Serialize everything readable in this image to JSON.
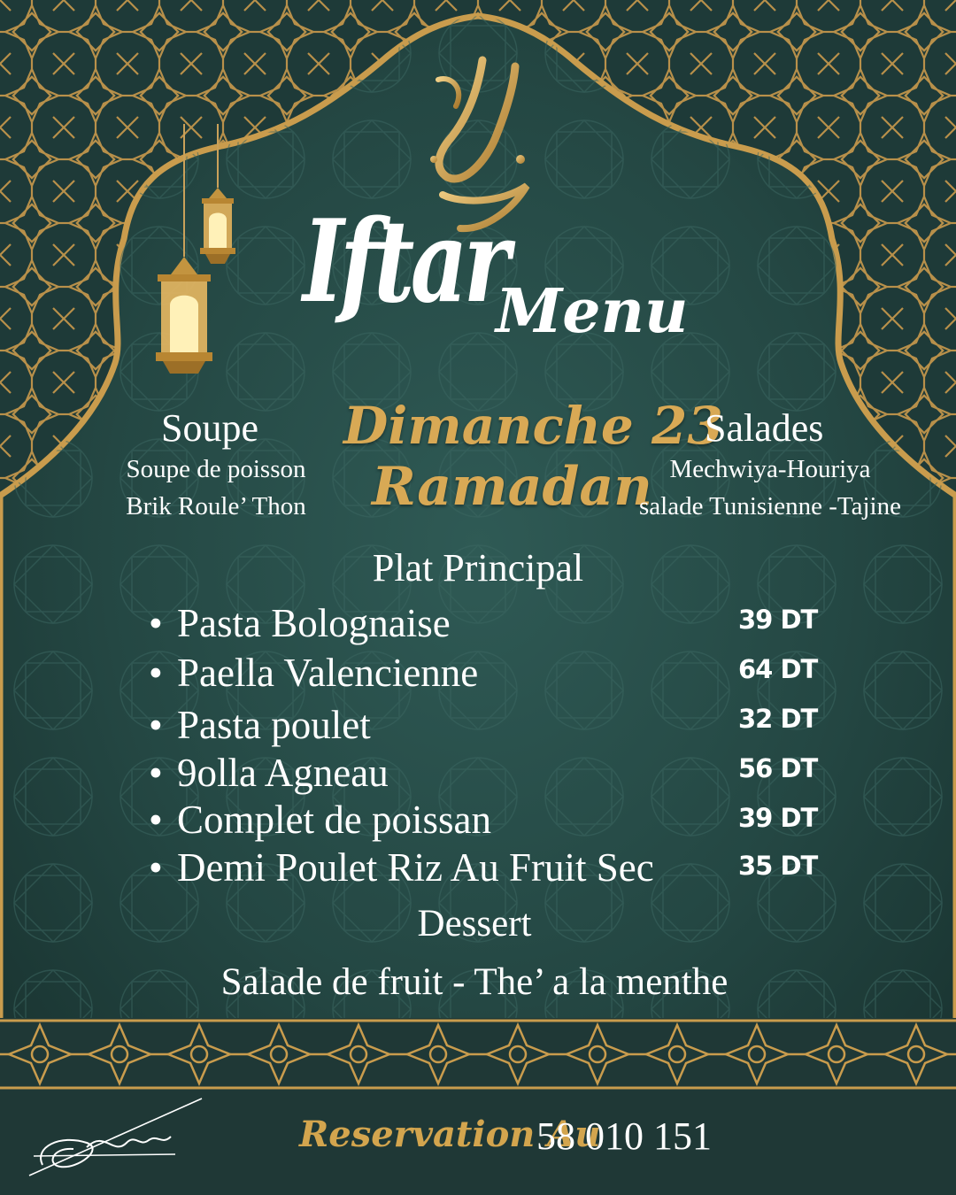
{
  "calligraphy": "رمضان",
  "title": {
    "iftar": "Iftar",
    "menu": "Menu"
  },
  "date": {
    "line1": "Dimanche 23",
    "line2": "Ramadan"
  },
  "soupe": {
    "heading": "Soupe",
    "items": [
      "Soupe de poisson",
      "Brik Roule’ Thon"
    ]
  },
  "salades": {
    "heading": "Salades",
    "items": [
      "Mechwiya-Houriya",
      "salade Tunisienne -Tajine"
    ]
  },
  "plat_principal": {
    "heading": "Plat Principal",
    "items": [
      {
        "name": "Pasta Bolognaise",
        "price": "39 DT"
      },
      {
        "name": "Paella Valencienne",
        "price": "64 DT"
      },
      {
        "name": "Pasta poulet",
        "price": "32 DT"
      },
      {
        "name": "9olla Agneau",
        "price": "56 DT"
      },
      {
        "name": "Complet de poissan",
        "price": "39 DT"
      },
      {
        "name": "Demi Poulet Riz Au Fruit Sec",
        "price": "35 DT"
      }
    ]
  },
  "dessert": {
    "heading": "Dessert",
    "text": "Salade de fruit - The’ a la menthe"
  },
  "reservation": {
    "label": "Reservation Au",
    "phone": "58 010 151"
  },
  "signature": "Achref.",
  "colors": {
    "background": "#1d3a36",
    "gold": "#d3a54e",
    "text": "#ffffff",
    "footer": "#1f3836"
  }
}
